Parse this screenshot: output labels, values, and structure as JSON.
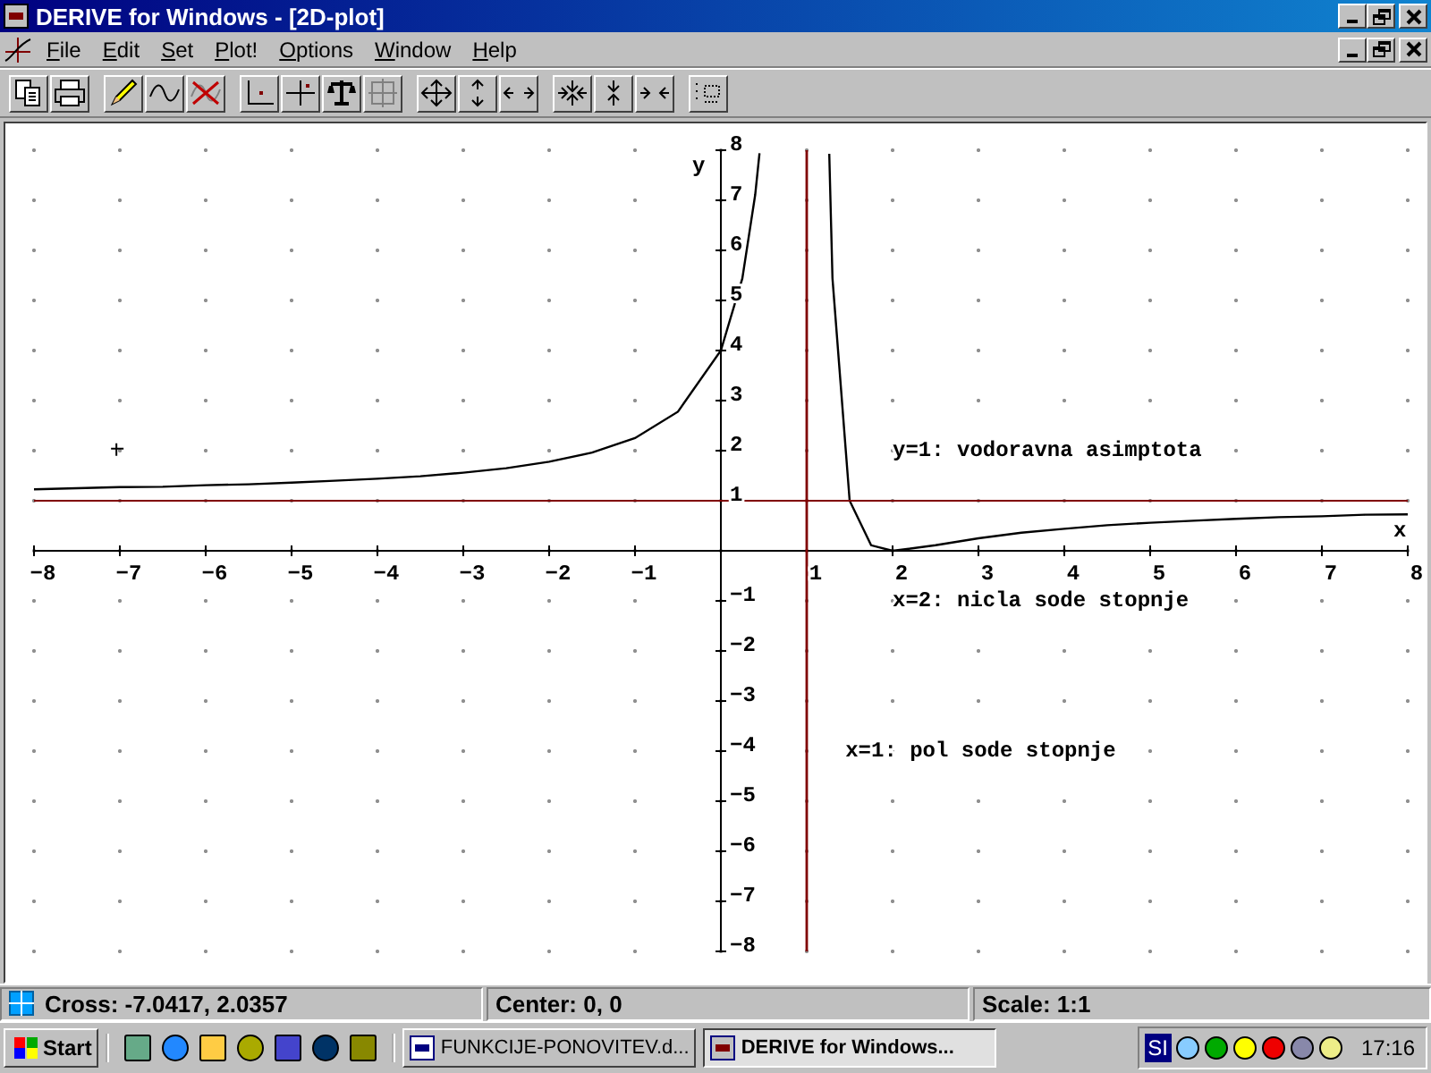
{
  "window": {
    "title": "DERIVE for Windows - [2D-plot]"
  },
  "menu": [
    "File",
    "Edit",
    "Set",
    "Plot!",
    "Options",
    "Window",
    "Help"
  ],
  "plot": {
    "chart_data": {
      "type": "line",
      "xlabel": "x",
      "ylabel": "y",
      "xlim": [
        -8,
        8
      ],
      "ylim": [
        -8,
        8
      ],
      "xticks": [
        -8,
        -7,
        -6,
        -5,
        -4,
        -3,
        -2,
        -1,
        1,
        2,
        3,
        4,
        5,
        6,
        7,
        8
      ],
      "yticks": [
        -8,
        -7,
        -6,
        -5,
        -4,
        -3,
        -2,
        -1,
        1,
        2,
        3,
        4,
        5,
        6,
        7,
        8
      ],
      "x": [
        -8,
        -7.5,
        -7,
        -6.5,
        -6,
        -5.5,
        -5,
        -4.5,
        -4,
        -3.5,
        -3,
        -2.5,
        -2,
        -1.5,
        -1,
        -0.5,
        0,
        0.25,
        0.4,
        0.45,
        1,
        1.262,
        1.3,
        1.5,
        1.75,
        2,
        2.5,
        3,
        3.5,
        4,
        4.5,
        5,
        5.5,
        6,
        6.5,
        7,
        7.5,
        8
      ],
      "series": [
        {
          "color": "#000000",
          "values": [
            1.23,
            1.25,
            1.27,
            1.28,
            1.31,
            1.33,
            1.36,
            1.4,
            1.44,
            1.49,
            1.56,
            1.65,
            1.78,
            1.96,
            2.25,
            2.78,
            4,
            5.44,
            7.11,
            7.94,
            null,
            7.93,
            5.44,
            1,
            0.11,
            0,
            0.11,
            0.25,
            0.36,
            0.44,
            0.51,
            0.56,
            0.6,
            0.64,
            0.67,
            0.69,
            0.72,
            0.73
          ]
        },
        {
          "color": "#800000",
          "values": [
            1,
            1,
            1,
            1,
            1,
            1,
            1,
            1,
            1,
            1,
            1,
            1,
            1,
            1,
            1,
            1,
            1,
            1,
            1,
            1,
            1,
            1,
            1,
            1,
            1,
            1,
            1,
            1,
            1,
            1,
            1,
            1,
            1,
            1,
            1,
            1,
            1,
            1
          ]
        }
      ],
      "ref_lines": [
        {
          "axis": "x",
          "value": 1,
          "color": "#800000"
        }
      ],
      "annotations": [
        "y=1: vodoravna asimptota",
        "x=2: nicla sode stopnje",
        "x=1: pol sode stopnje"
      ]
    }
  },
  "status_bar": [
    "Cross: -7.0417, 2.0357",
    "Center: 0, 0",
    "Scale: 1:1"
  ],
  "taskbar": {
    "start": "Start",
    "tasks": [
      {
        "label": "FUNKCIJE-PONOVITEV.d...",
        "selected": false
      },
      {
        "label": "DERIVE for Windows...",
        "selected": true
      }
    ],
    "language": "SI",
    "clock": "17:16"
  }
}
